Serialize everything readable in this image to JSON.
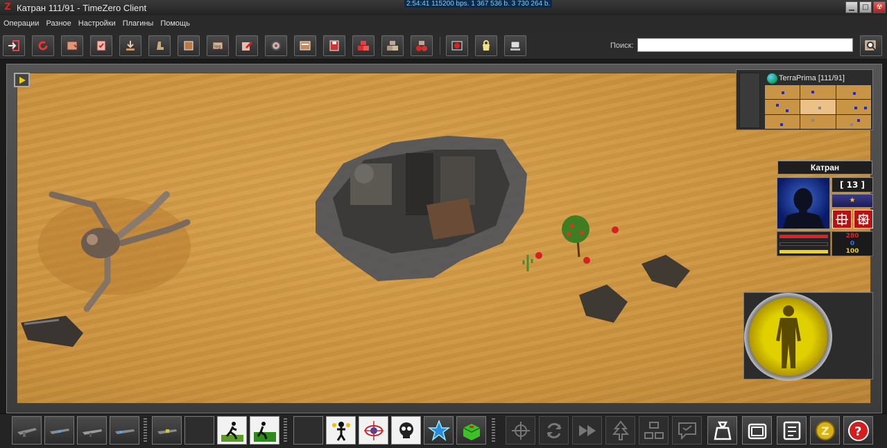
{
  "window": {
    "title": "Катран 111/91 - TimeZero Client",
    "stats": "2:54:41 115200 bps. 1 367 536 b. 3 730 264 b.",
    "controls": [
      "minimize",
      "maximize",
      "close"
    ]
  },
  "menu": {
    "items": [
      "Операции",
      "Разное",
      "Настройки",
      "Плагины",
      "Помощь"
    ]
  },
  "toolbar": {
    "search_label": "Поиск:",
    "search_value": "",
    "buttons": [
      "enter-icon",
      "refresh-icon",
      "map-icon",
      "notes-icon",
      "download-icon",
      "boot-icon",
      "box-icon",
      "log-icon",
      "edit-icon",
      "settings-icon",
      "window-icon",
      "save-icon",
      "crates-red-icon",
      "crates-icon",
      "crates-mixed-icon",
      "record-icon",
      "bag-icon",
      "computer-icon"
    ]
  },
  "minimap": {
    "title": "TerraPrima [111/91]"
  },
  "character": {
    "name": "Катран",
    "level": "13",
    "rank": "★",
    "hp": "280",
    "energy": "0",
    "power": "100"
  },
  "bottom_bar": {
    "slots": [
      "rifle-1",
      "rifle-2",
      "rifle-3",
      "rifle-4",
      "rifle-5",
      "empty",
      "run-icon",
      "run-escape-icon",
      "empty",
      "attack-man-icon",
      "aim-eye-icon",
      "skull-icon",
      "star-shield-icon",
      "green-box-icon"
    ],
    "actions": [
      "crosshair-icon",
      "cycle-icon",
      "fast-forward-icon",
      "tree-icon",
      "group-icon",
      "chat-icon",
      "bag-icon",
      "folder-icon",
      "list-icon",
      "coin-icon",
      "help-icon"
    ]
  },
  "colors": {
    "sand": "#c8903c",
    "accent_yellow": "#e0d000",
    "hp_red": "#e22222",
    "energy_blue": "#3d6bff",
    "power_yellow": "#f0d020"
  }
}
